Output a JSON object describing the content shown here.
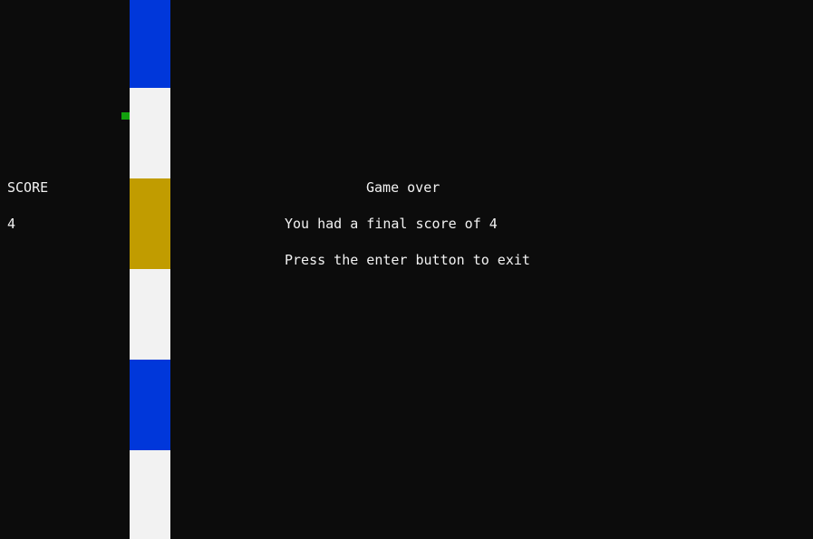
{
  "score_panel": {
    "label": "SCORE",
    "value": "4"
  },
  "game_over": {
    "title": "Game over",
    "final_score_message": "You had a final score of 4",
    "exit_prompt": "Press the enter button to exit"
  },
  "road": {
    "segments": [
      "blue",
      "white",
      "yellow",
      "white",
      "blue",
      "white"
    ]
  },
  "colors": {
    "background": "#0c0c0c",
    "text": "#f2f2f2",
    "blue": "#0037da",
    "white": "#f2f2f2",
    "yellow": "#c19c00",
    "player": "#13a10e"
  }
}
